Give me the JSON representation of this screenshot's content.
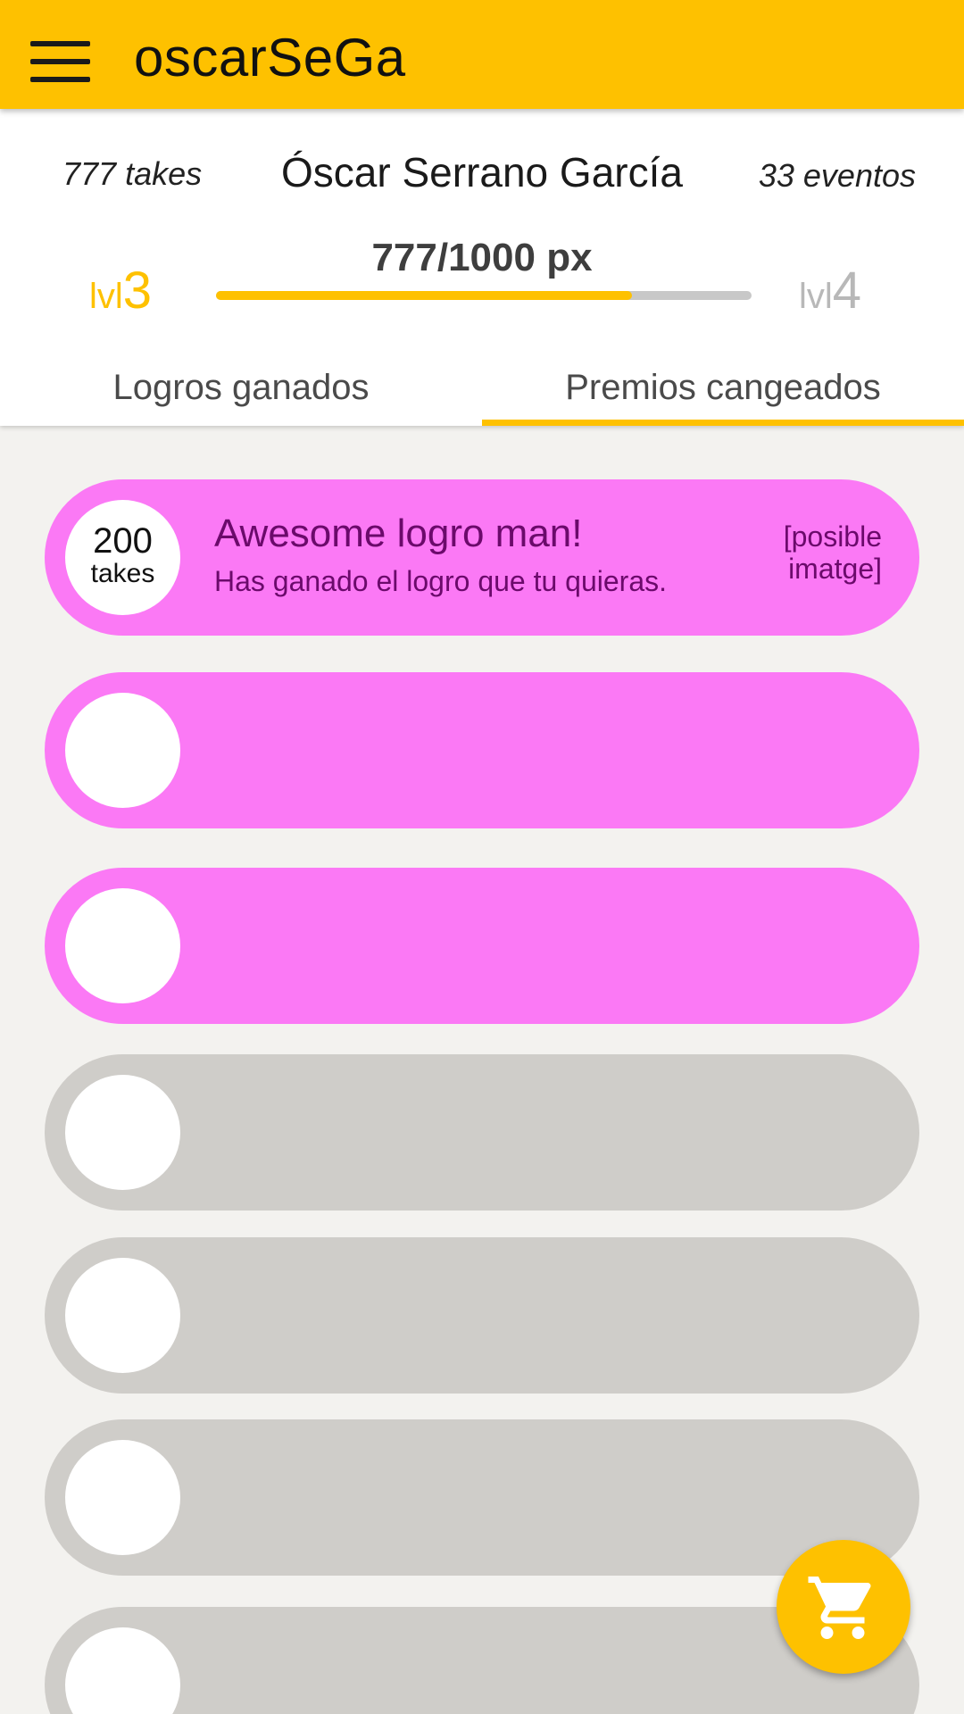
{
  "app": {
    "title": "oscarSeGa"
  },
  "profile": {
    "takes": "777 takes",
    "name": "Óscar Serrano García",
    "events": "33 eventos",
    "level_current": {
      "prefix": "lvl",
      "number": "3"
    },
    "level_next": {
      "prefix": "lvl",
      "number": "4"
    },
    "xp_text": "777/1000 px",
    "xp_progress": 0.777
  },
  "tabs": [
    {
      "label": "Logros ganados",
      "selected": false
    },
    {
      "label": "Premios cangeados",
      "selected": true
    }
  ],
  "achievements": [
    {
      "badge_value": "200",
      "badge_unit": "takes",
      "title": "Awesome logro man!",
      "description": "Has ganado el logro que tu quieras.",
      "image_placeholder": "[posible imatge]",
      "state": "unlocked"
    },
    {
      "badge_value": "",
      "badge_unit": "",
      "title": "",
      "description": "",
      "image_placeholder": "",
      "state": "unlocked"
    },
    {
      "badge_value": "",
      "badge_unit": "",
      "title": "",
      "description": "",
      "image_placeholder": "",
      "state": "unlocked"
    },
    {
      "badge_value": "",
      "badge_unit": "",
      "title": "",
      "description": "",
      "image_placeholder": "",
      "state": "locked"
    },
    {
      "badge_value": "",
      "badge_unit": "",
      "title": "",
      "description": "",
      "image_placeholder": "",
      "state": "locked"
    },
    {
      "badge_value": "",
      "badge_unit": "",
      "title": "",
      "description": "",
      "image_placeholder": "",
      "state": "locked"
    },
    {
      "badge_value": "",
      "badge_unit": "",
      "title": "",
      "description": "",
      "image_placeholder": "",
      "state": "locked"
    }
  ],
  "fab": {
    "icon": "cart-icon"
  },
  "colors": {
    "accent": "#fec100",
    "unlocked": "#fb79f5",
    "locked": "#cfcdc9",
    "card_text": "#6b0a6b"
  }
}
